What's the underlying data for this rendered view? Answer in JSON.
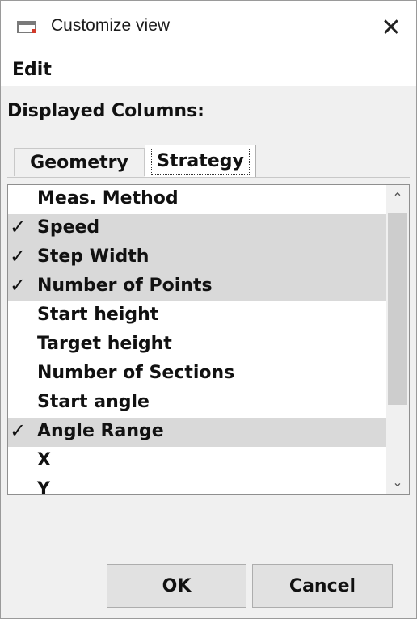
{
  "window": {
    "title": "Customize view",
    "close_symbol": "✕",
    "icon": "app-window-icon"
  },
  "menubar": {
    "edit_label": "Edit"
  },
  "section_label": "Displayed Columns:",
  "tabs": [
    {
      "label": "Geometry",
      "active": false
    },
    {
      "label": "Strategy",
      "active": true
    }
  ],
  "columns": [
    {
      "label": "Meas. Method",
      "checked": false,
      "mark": ""
    },
    {
      "label": "Speed",
      "checked": true,
      "mark": "✓"
    },
    {
      "label": "Step Width",
      "checked": true,
      "mark": "✓"
    },
    {
      "label": "Number of Points",
      "checked": true,
      "mark": "✓"
    },
    {
      "label": "Start height",
      "checked": false,
      "mark": ""
    },
    {
      "label": "Target height",
      "checked": false,
      "mark": ""
    },
    {
      "label": "Number of Sections",
      "checked": false,
      "mark": ""
    },
    {
      "label": "Start angle",
      "checked": false,
      "mark": ""
    },
    {
      "label": "Angle Range",
      "checked": true,
      "mark": "✓"
    },
    {
      "label": "X",
      "checked": false,
      "mark": ""
    },
    {
      "label": "Y",
      "checked": false,
      "mark": ""
    }
  ],
  "scrollbar": {
    "up_symbol": "⌃",
    "down_symbol": "⌄"
  },
  "buttons": {
    "ok_label": "OK",
    "cancel_label": "Cancel"
  },
  "colors": {
    "app_icon_accent": "#d23a2a",
    "checked_row_bg": "#d9d9d9"
  }
}
